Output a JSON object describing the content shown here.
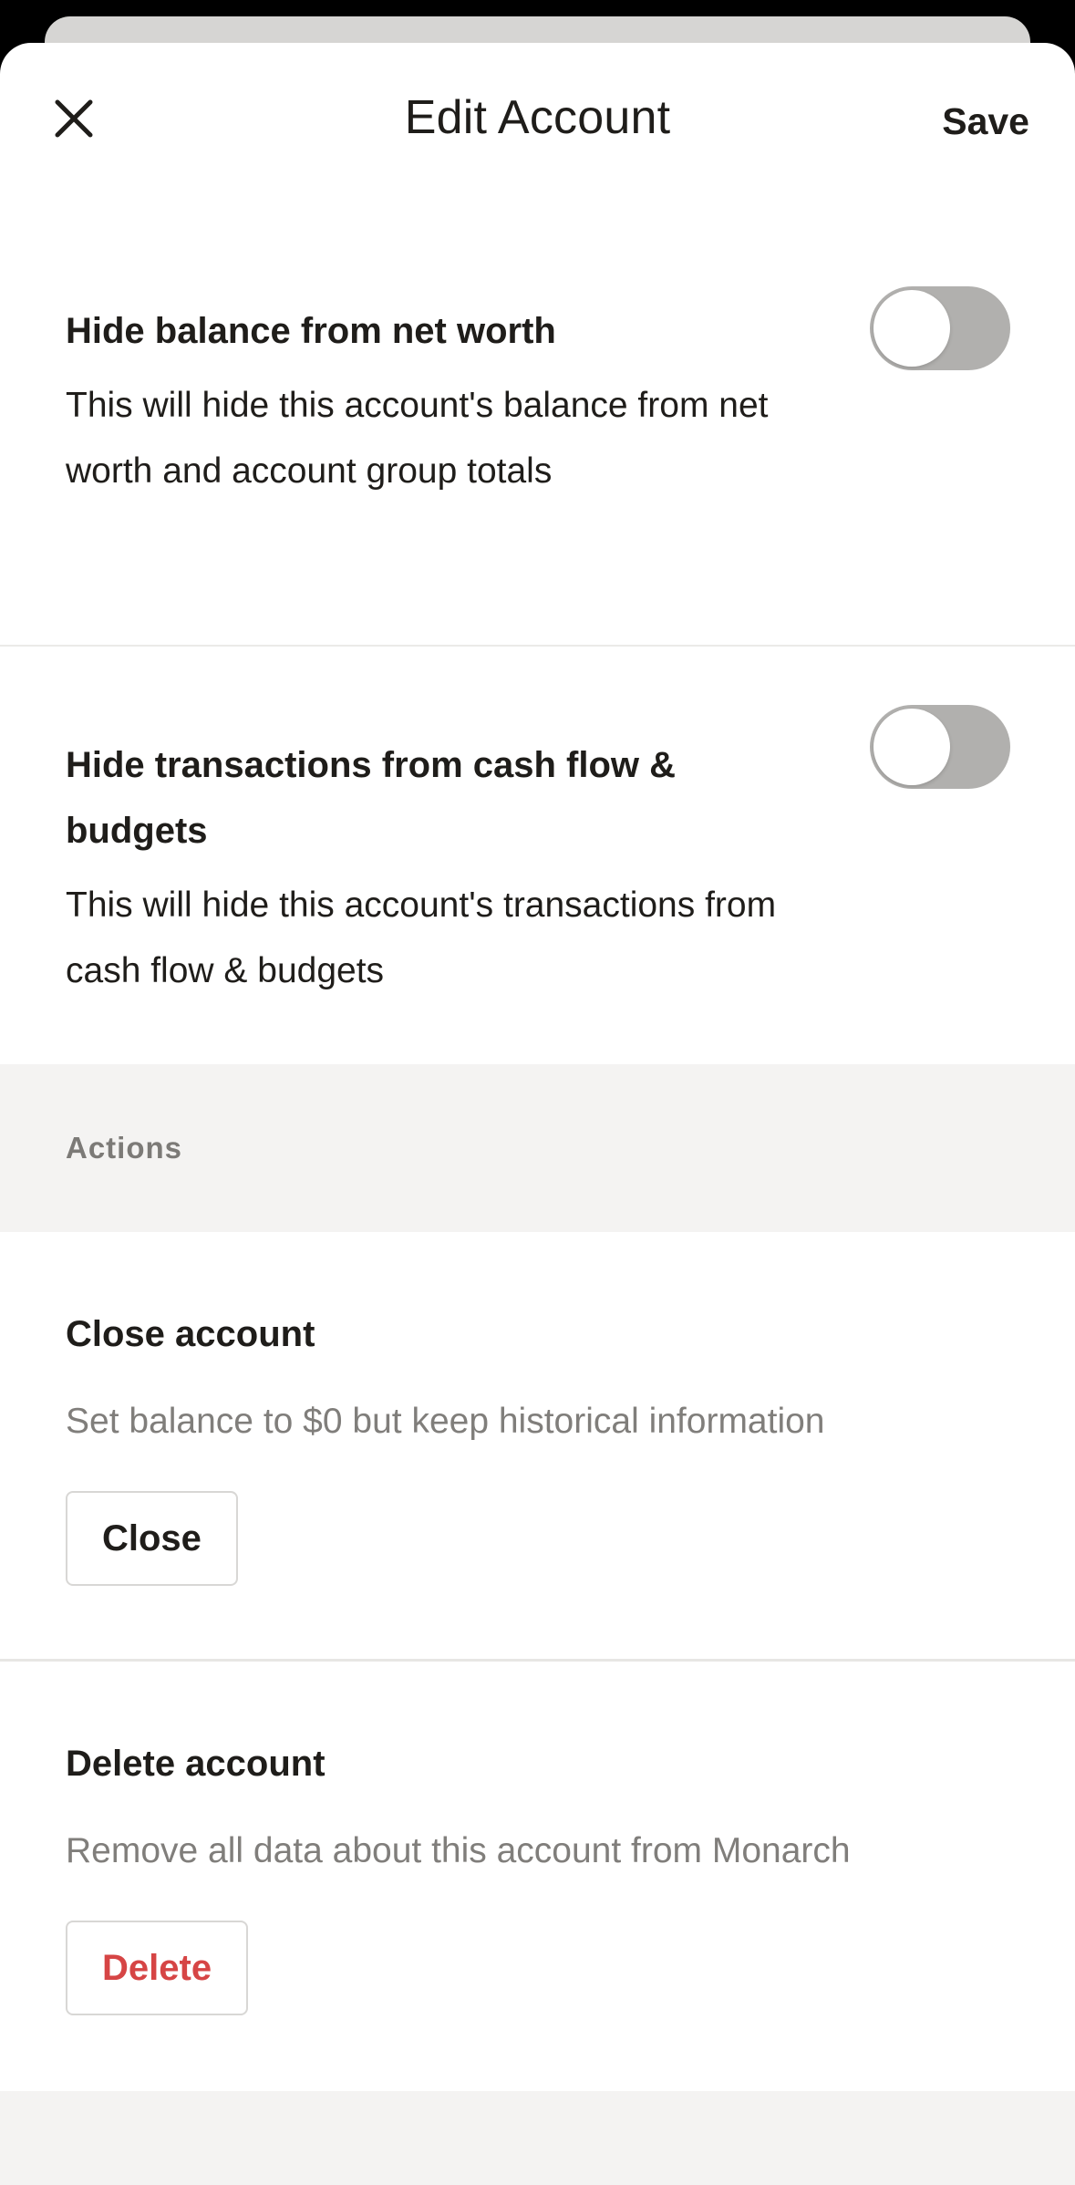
{
  "header": {
    "title": "Edit Account",
    "save_label": "Save",
    "close_icon": "close-icon"
  },
  "settings": [
    {
      "title": "Hide balance from net worth",
      "description": "This will hide this account's balance from net worth and account group totals",
      "enabled": false
    },
    {
      "title": "Hide transactions from cash flow & budgets",
      "description": "This will hide this account's transactions from cash flow & budgets",
      "enabled": false
    }
  ],
  "actions_section": {
    "label": "Actions",
    "close": {
      "title": "Close account",
      "description": "Set balance to $0 but keep historical information",
      "button_label": "Close"
    },
    "delete": {
      "title": "Delete account",
      "description": "Remove all data about this account from Monarch",
      "button_label": "Delete"
    }
  },
  "colors": {
    "text_primary": "#1f1d1a",
    "text_secondary": "#807e7b",
    "toggle_off": "#b1b0ae",
    "danger": "#d64545",
    "section_bg": "#f4f3f2"
  }
}
